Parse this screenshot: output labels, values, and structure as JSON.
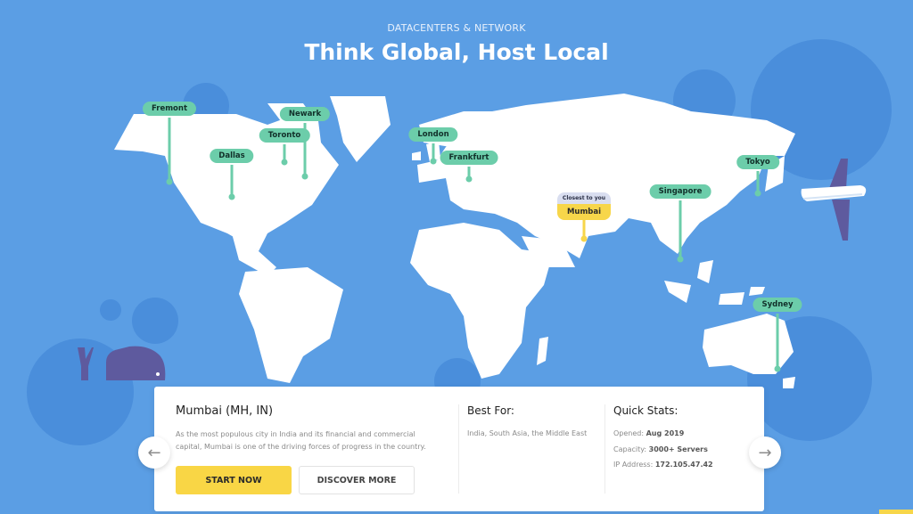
{
  "header": {
    "eyebrow": "DATACENTERS & NETWORK",
    "title": "Think Global, Host Local"
  },
  "locations": [
    {
      "name": "Fremont"
    },
    {
      "name": "Dallas"
    },
    {
      "name": "Toronto"
    },
    {
      "name": "Newark"
    },
    {
      "name": "London"
    },
    {
      "name": "Frankfurt"
    },
    {
      "name": "Singapore"
    },
    {
      "name": "Tokyo"
    },
    {
      "name": "Sydney"
    }
  ],
  "selected": {
    "badge": "Closest to you",
    "name": "Mumbai"
  },
  "card": {
    "city_title": "Mumbai (MH, IN)",
    "description": "As the most populous city in India and its financial and commercial capital, Mumbai is one of the driving forces of progress in the country.",
    "start_label": "START NOW",
    "discover_label": "DISCOVER MORE",
    "best_for_title": "Best For:",
    "best_for_text": "India, South Asia, the Middle East",
    "stats_title": "Quick Stats:",
    "stats": [
      {
        "label": "Opened:",
        "value": "Aug 2019"
      },
      {
        "label": "Capacity:",
        "value": "3000+ Servers"
      },
      {
        "label": "IP Address:",
        "value": "172.105.47.42"
      }
    ]
  },
  "nav": {
    "prev_icon": "arrow-left-icon",
    "next_icon": "arrow-right-icon"
  },
  "colors": {
    "background": "#5b9ee4",
    "pin": "#6ccdaa",
    "active_pin": "#f7d64a",
    "primary_button": "#f9d645"
  }
}
